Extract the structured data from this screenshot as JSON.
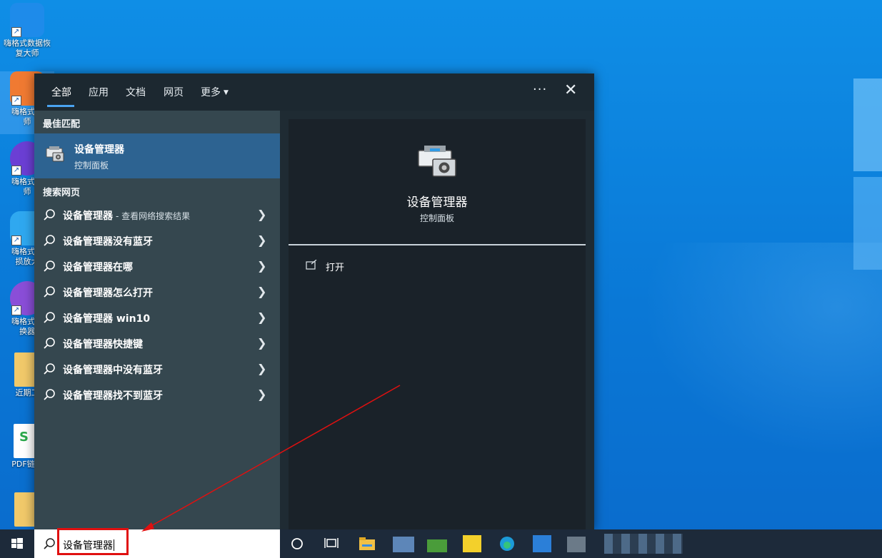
{
  "desktop": {
    "icons": [
      {
        "label": "嗨格式数据恢\n复大师",
        "icon": "data-recovery-icon"
      },
      {
        "label": "嗨格式压\n师",
        "icon": "compress-icon"
      },
      {
        "label": "嗨格式录\n师",
        "icon": "recorder-icon"
      },
      {
        "label": "嗨格式图\n损放大",
        "icon": "image-enlarge-icon"
      },
      {
        "label": "嗨格式视\n换器",
        "icon": "video-converter-icon"
      },
      {
        "label": "近期工",
        "icon": "folder-icon"
      },
      {
        "label": "PDF链接",
        "icon": "spreadsheet-icon"
      },
      {
        "label": "",
        "icon": "folder-icon"
      }
    ]
  },
  "search_panel": {
    "tabs": [
      {
        "label": "全部",
        "active": true
      },
      {
        "label": "应用",
        "active": false
      },
      {
        "label": "文档",
        "active": false
      },
      {
        "label": "网页",
        "active": false
      },
      {
        "label": "更多",
        "active": false
      }
    ],
    "more_options": "···",
    "close": "✕",
    "best_match_label": "最佳匹配",
    "best_match": {
      "title": "设备管理器",
      "subtitle": "控制面板"
    },
    "web_search_label": "搜索网页",
    "web_results": [
      {
        "text": "设备管理器",
        "suffix": "- 查看网络搜索结果"
      },
      {
        "text": "设备管理器没有蓝牙",
        "suffix": ""
      },
      {
        "text": "设备管理器在哪",
        "suffix": ""
      },
      {
        "text": "设备管理器怎么打开",
        "suffix": ""
      },
      {
        "text": "设备管理器 win10",
        "suffix": ""
      },
      {
        "text": "设备管理器快捷键",
        "suffix": ""
      },
      {
        "text": "设备管理器中没有蓝牙",
        "suffix": ""
      },
      {
        "text": "设备管理器找不到蓝牙",
        "suffix": ""
      }
    ],
    "detail": {
      "title": "设备管理器",
      "subtitle": "控制面板",
      "action_open": "打开"
    }
  },
  "taskbar": {
    "search_query": "设备管理器"
  },
  "colors": {
    "accent": "#4aa3f0",
    "selected_row": "#2d6391",
    "annotation": "#e01010"
  }
}
